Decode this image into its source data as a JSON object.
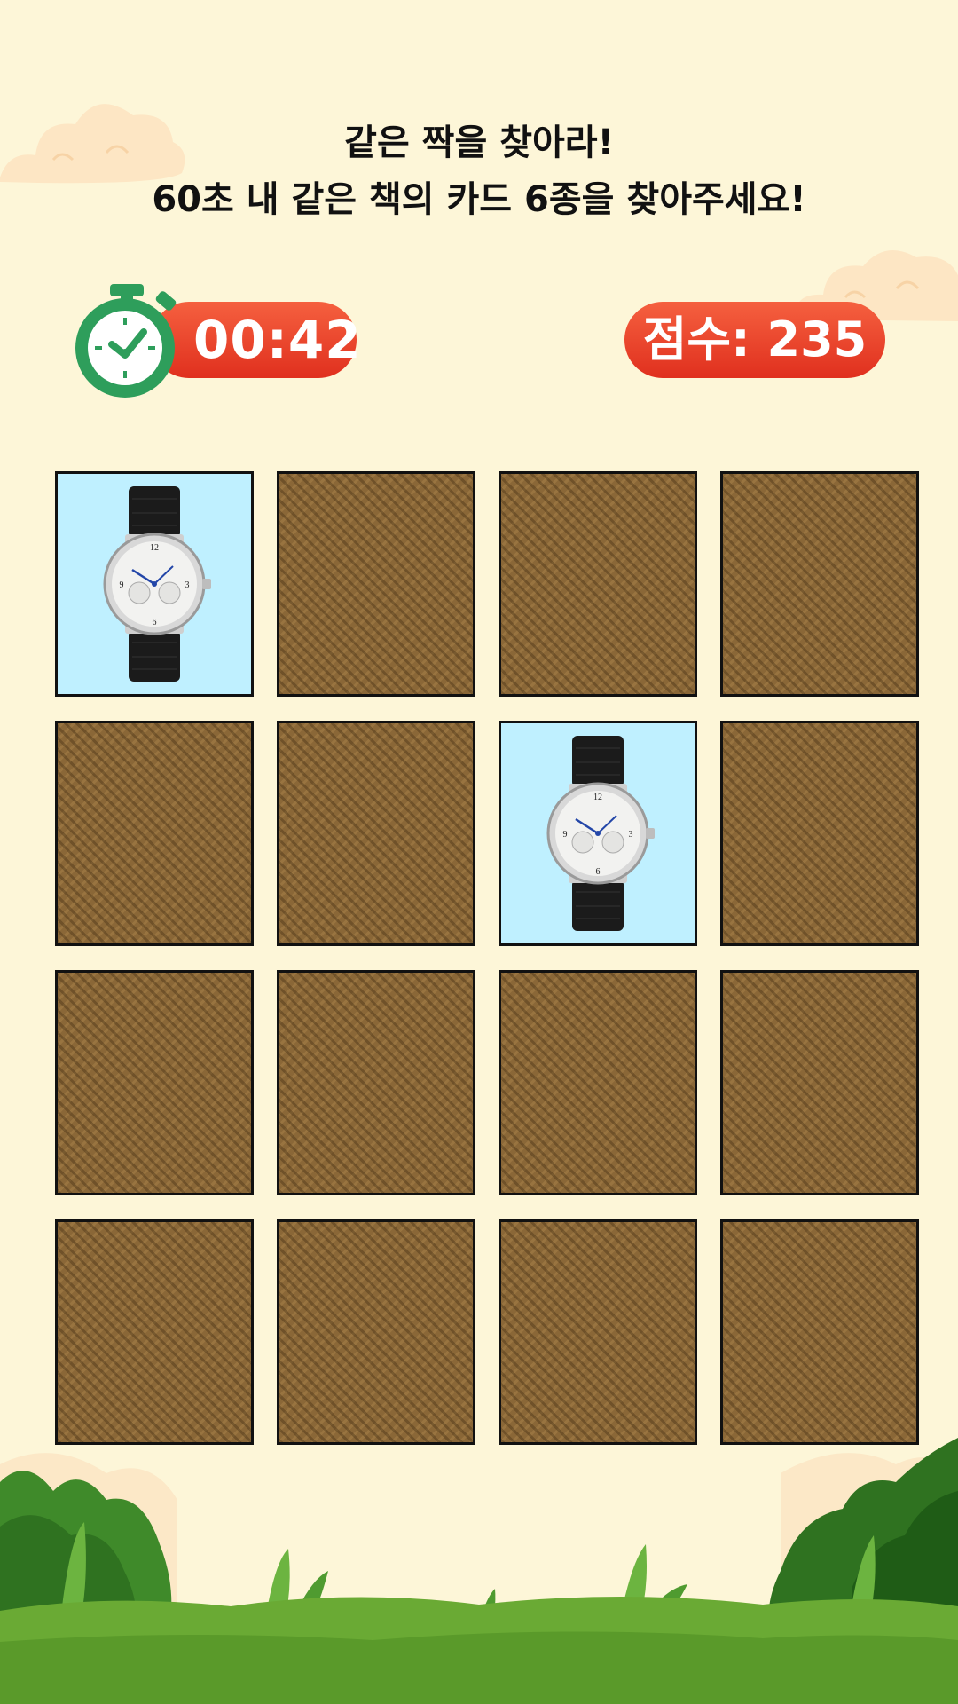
{
  "header": {
    "line1": "같은 짝을 찾아라!",
    "line2": "60초 내 같은 책의 카드 6종을 찾아주세요!"
  },
  "timer": {
    "value": "00:42",
    "icon": "stopwatch-icon"
  },
  "score": {
    "label": "점수:",
    "value": "235"
  },
  "board": {
    "rows": 4,
    "cols": 4,
    "revealed": [
      {
        "row": 1,
        "col": 1,
        "image": "wristwatch"
      },
      {
        "row": 2,
        "col": 3,
        "image": "wristwatch"
      }
    ]
  },
  "colors": {
    "background": "#fdf6d8",
    "pill": "#e8402a",
    "stopwatch": "#2e9e5b",
    "card_back": "#8a6737",
    "card_front": "#bff0ff",
    "grass": "#5aa02c"
  }
}
